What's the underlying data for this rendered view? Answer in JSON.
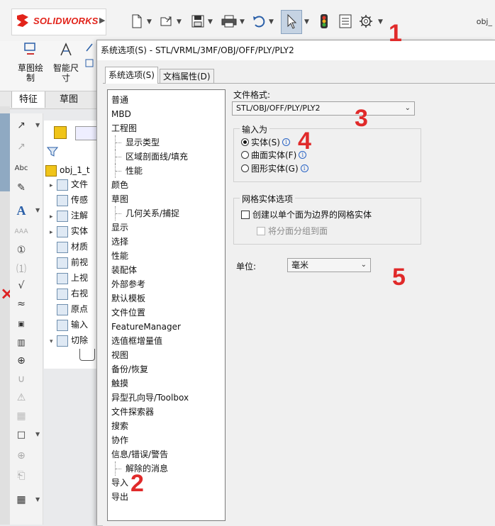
{
  "app": {
    "logo_text": "SOLIDWORKS",
    "top_right_text": "obj_",
    "brand_color": "#e2231a"
  },
  "toolbar": {
    "icons": [
      "new-document-icon",
      "open-icon",
      "save-icon",
      "print-icon",
      "undo-icon",
      "select-pointer-icon",
      "traffic-light-icon",
      "file-properties-icon",
      "options-gear-icon"
    ]
  },
  "ribbon": {
    "sketch_label": "草图绘\n制",
    "smart_dim_label": "智能尺\n寸",
    "tabs": [
      "特征",
      "草图"
    ]
  },
  "feature_tree": {
    "root": "obj_1_t",
    "items": [
      "文件",
      "传感",
      "注解",
      "实体",
      "材质",
      "前视",
      "上视",
      "右视",
      "原点",
      "输入",
      "切除"
    ]
  },
  "dialog": {
    "title": "系统选项(S) - STL/VRML/3MF/OBJ/OFF/PLY/PLY2",
    "tabs": [
      "系统选项(S)",
      "文档属性(D)"
    ],
    "nav": [
      {
        "label": "普通",
        "sub": false
      },
      {
        "label": "MBD",
        "sub": false
      },
      {
        "label": "工程图",
        "sub": false
      },
      {
        "label": "显示类型",
        "sub": true
      },
      {
        "label": "区域剖面线/填充",
        "sub": true
      },
      {
        "label": "性能",
        "sub": true
      },
      {
        "label": "颜色",
        "sub": false
      },
      {
        "label": "草图",
        "sub": false
      },
      {
        "label": "几何关系/捕捉",
        "sub": true
      },
      {
        "label": "显示",
        "sub": false
      },
      {
        "label": "选择",
        "sub": false
      },
      {
        "label": "性能",
        "sub": false
      },
      {
        "label": "装配体",
        "sub": false
      },
      {
        "label": "外部参考",
        "sub": false
      },
      {
        "label": "默认模板",
        "sub": false
      },
      {
        "label": "文件位置",
        "sub": false
      },
      {
        "label": "FeatureManager",
        "sub": false
      },
      {
        "label": "选值框增量值",
        "sub": false
      },
      {
        "label": "视图",
        "sub": false
      },
      {
        "label": "备份/恢复",
        "sub": false
      },
      {
        "label": "触摸",
        "sub": false
      },
      {
        "label": "异型孔向导/Toolbox",
        "sub": false
      },
      {
        "label": "文件探索器",
        "sub": false
      },
      {
        "label": "搜索",
        "sub": false
      },
      {
        "label": "协作",
        "sub": false
      },
      {
        "label": "信息/错误/警告",
        "sub": false
      },
      {
        "label": "解除的消息",
        "sub": true
      },
      {
        "label": "导入",
        "sub": false
      },
      {
        "label": "导出",
        "sub": false
      }
    ],
    "file_format_label": "文件格式:",
    "file_format_value": "STL/OBJ/OFF/PLY/PLY2",
    "import_as": {
      "title": "输入为",
      "options": [
        {
          "label": "实体(S)",
          "selected": true
        },
        {
          "label": "曲面实体(F)",
          "selected": false
        },
        {
          "label": "图形实体(G)",
          "selected": false
        }
      ]
    },
    "mesh_options": {
      "title": "网格实体选项",
      "checkbox1": "创建以单个面为边界的网格实体",
      "checkbox2": "将分面分组到面"
    },
    "unit_label": "单位:",
    "unit_value": "毫米"
  },
  "annotations": [
    "1",
    "2",
    "3",
    "4",
    "5"
  ]
}
